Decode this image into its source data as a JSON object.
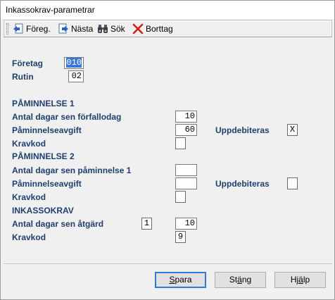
{
  "window": {
    "title": "Inkassokrav-parametrar"
  },
  "toolbar": {
    "prev_label": "Föreg.",
    "next_label": "Nästa",
    "search_label": "Sök",
    "delete_label": "Borttag",
    "icons": {
      "prev": "prev-record-icon",
      "next": "next-record-icon",
      "search": "binoculars-icon",
      "delete": "red-x-icon"
    }
  },
  "form": {
    "foretag_label": "Företag",
    "foretag_value": "010",
    "rutin_label": "Rutin",
    "rutin_value": "02",
    "pam1": {
      "header": "PÅMINNELSE 1",
      "antal_label": "Antal dagar sen förfallodag",
      "antal_value": "10",
      "avgift_label": "Påminnelseavgift",
      "avgift_value": "60",
      "uppdeb_label": "Uppdebiteras",
      "uppdeb_value": "X",
      "kravkod_label": "Kravkod",
      "kravkod_value": ""
    },
    "pam2": {
      "header": "PÅMINNELSE 2",
      "antal_label": "Antal dagar sen påminnelse 1",
      "antal_value": "",
      "avgift_label": "Påminnelseavgift",
      "avgift_value": "",
      "uppdeb_label": "Uppdebiteras",
      "uppdeb_value": "",
      "kravkod_label": "Kravkod",
      "kravkod_value": ""
    },
    "inkasso": {
      "header": "INKASSOKRAV",
      "antal_label": "Antal dagar sen åtgärd",
      "atgard_value": "1",
      "antal_value": "10",
      "kravkod_label": "Kravkod",
      "kravkod_value": "9"
    }
  },
  "buttons": {
    "spara_first": "S",
    "spara_rest": "para",
    "stang_pre": "St",
    "stang_u": "ä",
    "stang_rest": "ng",
    "hjalp_pre": "Hj",
    "hjalp_u": "ä",
    "hjalp_rest": "lp"
  }
}
